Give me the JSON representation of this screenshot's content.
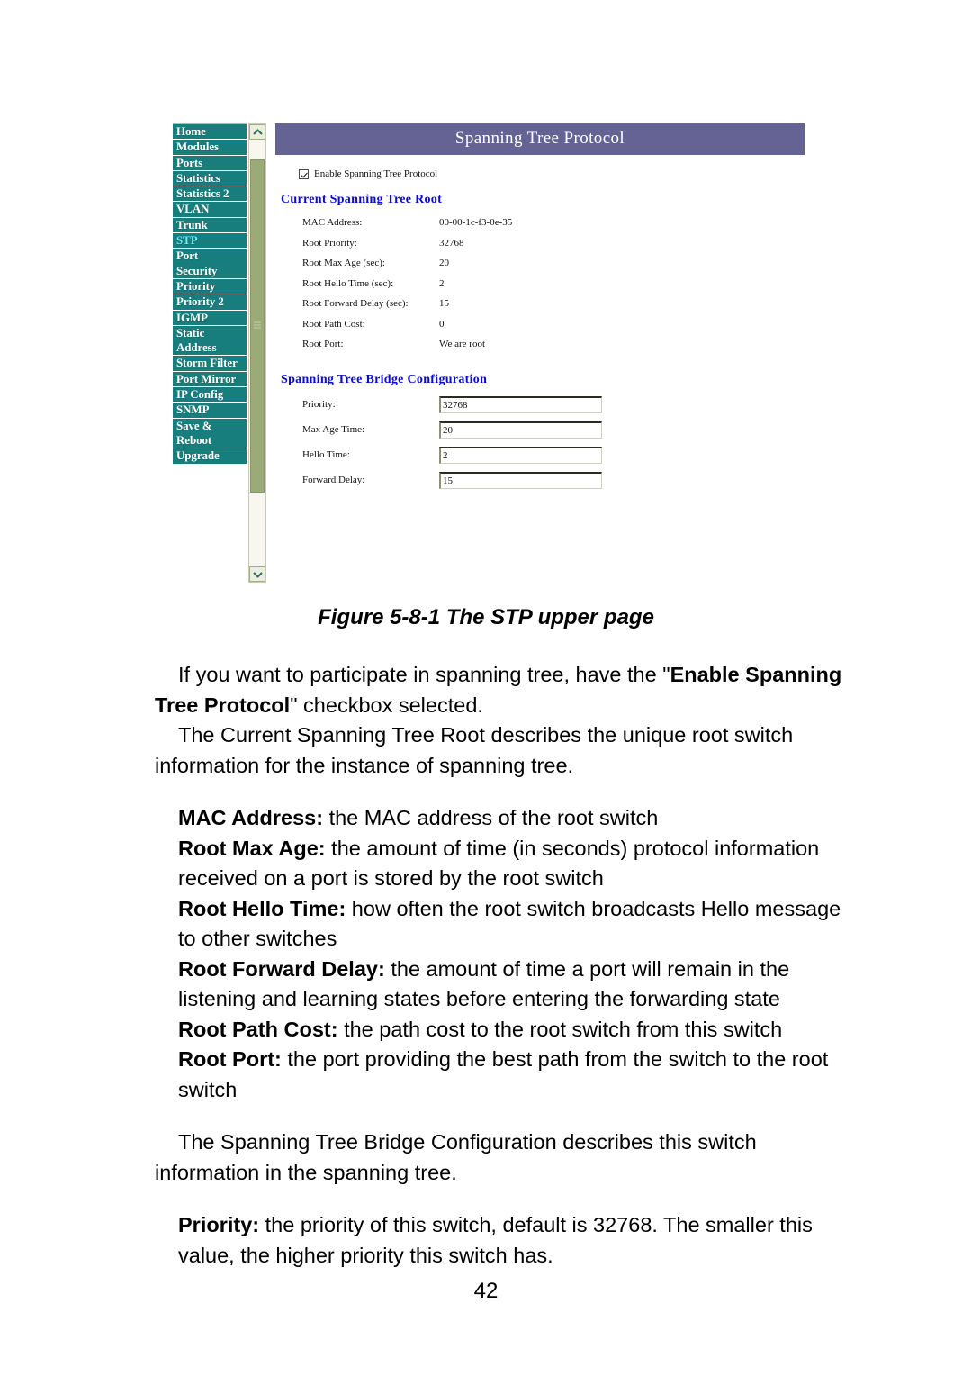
{
  "screenshot": {
    "sidebar": {
      "items": [
        {
          "label": "Home",
          "active": false
        },
        {
          "label": "Modules",
          "active": false
        },
        {
          "label": "Ports",
          "active": false
        },
        {
          "label": "Statistics",
          "active": false
        },
        {
          "label": "Statistics 2",
          "active": false
        },
        {
          "label": "VLAN",
          "active": false
        },
        {
          "label": "Trunk",
          "active": false
        },
        {
          "label": "STP",
          "active": true
        },
        {
          "label": "Port\nSecurity",
          "active": false
        },
        {
          "label": "Priority",
          "active": false
        },
        {
          "label": "Priority 2",
          "active": false
        },
        {
          "label": "IGMP",
          "active": false
        },
        {
          "label": "Static\nAddress",
          "active": false
        },
        {
          "label": "Storm Filter",
          "active": false
        },
        {
          "label": "Port Mirror",
          "active": false
        },
        {
          "label": "IP Config",
          "active": false
        },
        {
          "label": "SNMP",
          "active": false
        },
        {
          "label": "Save &\nReboot",
          "active": false
        },
        {
          "label": "Upgrade",
          "active": false
        }
      ],
      "colors": {
        "background": "#187d7d",
        "text": "#ffffff",
        "active_text": "#6ff0ec"
      }
    },
    "scrollbar": {
      "up_arrow": "chevron-up-icon",
      "down_arrow": "chevron-down-icon",
      "thumb_color": "#9aab78",
      "track_color": "#f7f7f0"
    },
    "panel": {
      "title": "Spanning Tree Protocol",
      "title_bar_color": "#646393",
      "enable_checkbox": {
        "label": "Enable Spanning Tree Protocol",
        "checked": true
      },
      "root_section": {
        "heading": "Current Spanning Tree Root",
        "heading_color": "#0a0ad0",
        "rows": [
          {
            "key": "MAC Address:",
            "value": "00-00-1c-f3-0e-35"
          },
          {
            "key": "Root Priority:",
            "value": "32768"
          },
          {
            "key": "Root Max Age (sec):",
            "value": "20"
          },
          {
            "key": "Root Hello Time (sec):",
            "value": "2"
          },
          {
            "key": "Root Forward Delay (sec):",
            "value": "15"
          },
          {
            "key": "Root Path Cost:",
            "value": "0"
          },
          {
            "key": "Root Port:",
            "value": "We are root"
          }
        ]
      },
      "bridge_section": {
        "heading": "Spanning Tree Bridge Configuration",
        "heading_color": "#0a0ad0",
        "fields": [
          {
            "key": "Priority:",
            "value": "32768"
          },
          {
            "key": "Max Age Time:",
            "value": "20"
          },
          {
            "key": "Hello Time:",
            "value": "2"
          },
          {
            "key": "Forward Delay:",
            "value": "15"
          }
        ]
      }
    }
  },
  "document": {
    "caption": "Figure 5-8-1 The STP upper page",
    "page_number": "42",
    "paragraphs": {
      "p1_a": "If you want to participate in spanning tree, have the \"",
      "p1_b": "Enable Spanning Tree Protocol",
      "p1_c": "\" checkbox selected.",
      "p2": "The Current Spanning Tree Root describes the unique root switch information for the instance of spanning tree.",
      "d1_term": "MAC Address:",
      "d1_text": " the MAC address of the root switch",
      "d2_term": "Root Max Age:",
      "d2_text": " the amount of time (in seconds) protocol information received on a port is stored by the root switch",
      "d3_term": "Root Hello Time:",
      "d3_text": " how often the root switch broadcasts Hello message to other switches",
      "d4_term": "Root Forward Delay:",
      "d4_text": " the amount of time a port will remain in the listening and learning states before entering the forwarding state",
      "d5_term": "Root Path Cost:",
      "d5_text": " the path cost to the root switch from this switch",
      "d6_term": "Root Port:",
      "d6_text": " the port providing the best path from the switch to the root switch",
      "p3": "The Spanning Tree Bridge Configuration describes this switch information in the spanning tree.",
      "d7_term": "Priority:",
      "d7_text": " the priority of this switch, default is 32768. The smaller this value, the higher priority this switch has."
    }
  }
}
